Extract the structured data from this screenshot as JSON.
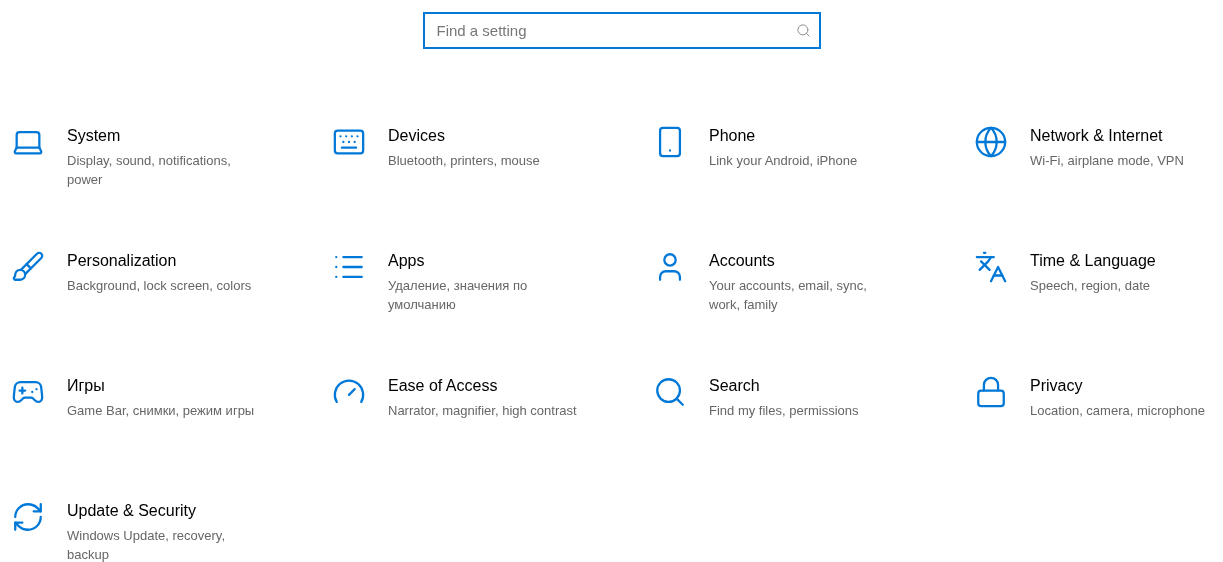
{
  "search": {
    "placeholder": "Find a setting"
  },
  "categories": [
    {
      "title": "System",
      "description": "Display, sound, notifications, power"
    },
    {
      "title": "Devices",
      "description": "Bluetooth, printers, mouse"
    },
    {
      "title": "Phone",
      "description": "Link your Android, iPhone"
    },
    {
      "title": "Network & Internet",
      "description": "Wi-Fi, airplane mode, VPN"
    },
    {
      "title": "Personalization",
      "description": "Background, lock screen, colors"
    },
    {
      "title": "Apps",
      "description": "Удаление, значения по умолчанию"
    },
    {
      "title": "Accounts",
      "description": "Your accounts, email, sync, work, family"
    },
    {
      "title": "Time & Language",
      "description": "Speech, region, date"
    },
    {
      "title": "Игры",
      "description": "Game Bar, снимки, режим игры"
    },
    {
      "title": "Ease of Access",
      "description": "Narrator, magnifier, high contrast"
    },
    {
      "title": "Search",
      "description": "Find my files, permissions"
    },
    {
      "title": "Privacy",
      "description": "Location, camera, microphone"
    },
    {
      "title": "Update & Security",
      "description": "Windows Update, recovery, backup"
    }
  ]
}
